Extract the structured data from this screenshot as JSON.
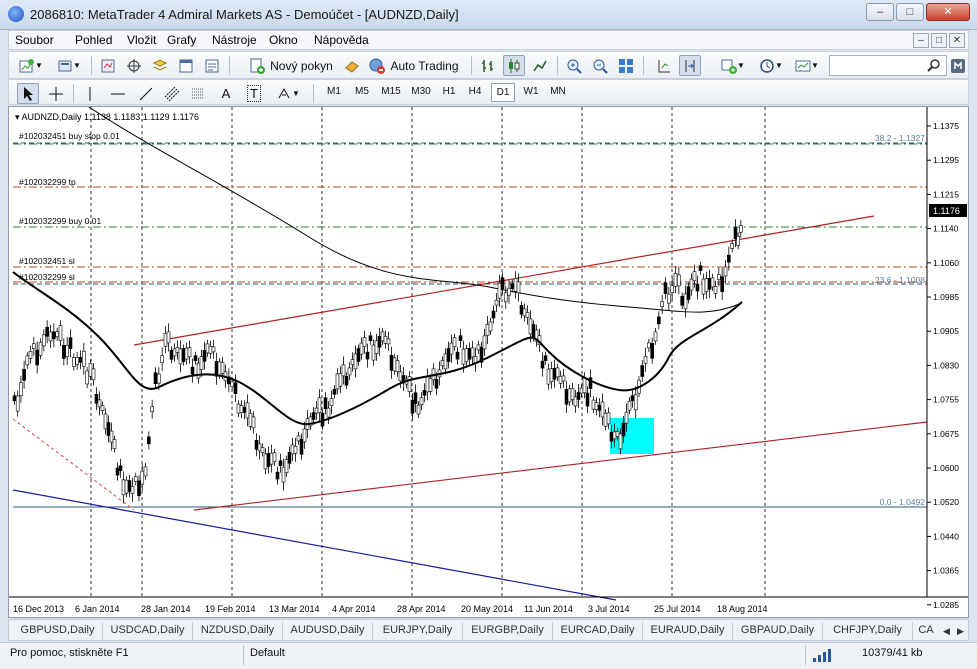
{
  "window": {
    "title": "2086810: MetaTrader 4 Admiral Markets AS - Demoúčet - [AUDNZD,Daily]",
    "minimize": "–",
    "maximize": "□",
    "close": "✕"
  },
  "menu": {
    "items": [
      "Soubor",
      "Pohled",
      "Vložit",
      "Grafy",
      "Nástroje",
      "Okno",
      "Nápověda"
    ],
    "mdi": [
      "–",
      "□",
      "✕"
    ]
  },
  "toolbar1": {
    "new_order_label": "Nový pokyn",
    "auto_trading_label": "Auto Trading",
    "search_placeholder": "",
    "icons": [
      "new-chart-icon",
      "profiles-icon",
      "market-watch-icon",
      "navigator-icon",
      "data-window-icon",
      "terminal-icon",
      "new-order-icon",
      "metaeditor-icon",
      "auto-trading-icon",
      "bar-chart-icon",
      "candle-chart-icon",
      "line-chart-icon",
      "zoom-in-icon",
      "zoom-out-icon",
      "tile-windows-icon",
      "chart-shift-icon",
      "autoscroll-icon",
      "indicators-icon",
      "periods-icon",
      "templates-icon"
    ]
  },
  "toolbar2": {
    "text_tool": "A",
    "label_tool": "T",
    "timeframes": [
      "M1",
      "M5",
      "M15",
      "M30",
      "H1",
      "H4",
      "D1",
      "W1",
      "MN"
    ],
    "active_timeframe": "D1"
  },
  "chart": {
    "header": "AUDNZD,Daily  1.1138 1.1183 1.1129 1.1176",
    "current_price": "1.1176",
    "price_labels": [
      "1.1375",
      "1.1295",
      "1.1215",
      "1.1140",
      "1.1060",
      "1.0985",
      "1.0905",
      "1.0830",
      "1.0755",
      "1.0675",
      "1.0600",
      "1.0520",
      "1.0440",
      "1.0365",
      "1.0285"
    ],
    "date_labels": [
      "16 Dec 2013",
      "6 Jan 2014",
      "28 Jan 2014",
      "19 Feb 2014",
      "13 Mar 2014",
      "4 Apr 2014",
      "28 Apr 2014",
      "20 May 2014",
      "11 Jun 2014",
      "3 Jul 2014",
      "25 Jul 2014",
      "18 Aug 2014"
    ],
    "order_labels": [
      "#102032451 buy stop 0.01",
      "#102032299 tp",
      "#102032299 buy 0.01",
      "#102032451 sl",
      "#102032299 sl"
    ],
    "fibo_labels": [
      "38.2 - 1.1327",
      "23.6 - 1.1008",
      "0.0 - 1.0492"
    ],
    "colors": {
      "buy_line": "#2e7d32",
      "tp_sl_line": "#c0471b",
      "channel": "#b22222",
      "ma": "#000000",
      "fibo": "#5a7fa0",
      "rectangle": "#00ffff",
      "trendline_blue": "#1b1b9e"
    }
  },
  "tabs": {
    "items": [
      "GBPUSD,Daily",
      "USDCAD,Daily",
      "NZDUSD,Daily",
      "AUDUSD,Daily",
      "EURJPY,Daily",
      "EURGBP,Daily",
      "EURCAD,Daily",
      "EURAUD,Daily",
      "GBPAUD,Daily",
      "CHFJPY,Daily",
      "CA"
    ],
    "prev": "◀",
    "next": "▶"
  },
  "status": {
    "help": "Pro pomoc, stiskněte F1",
    "profile": "Default",
    "traffic": "10379/41 kb"
  }
}
